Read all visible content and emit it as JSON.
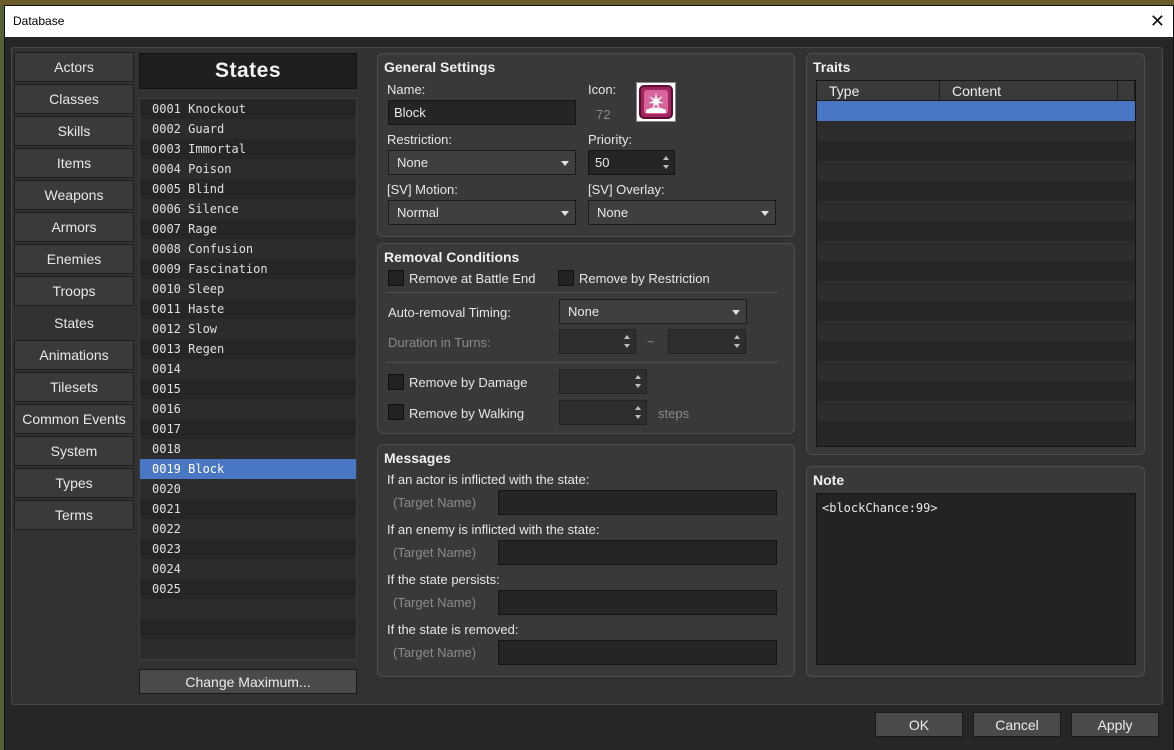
{
  "window": {
    "title": "Database",
    "close_glyph": "✕"
  },
  "categories": [
    {
      "label": "Actors"
    },
    {
      "label": "Classes"
    },
    {
      "label": "Skills"
    },
    {
      "label": "Items"
    },
    {
      "label": "Weapons"
    },
    {
      "label": "Armors"
    },
    {
      "label": "Enemies"
    },
    {
      "label": "Troops"
    },
    {
      "label": "States",
      "active": true
    },
    {
      "label": "Animations"
    },
    {
      "label": "Tilesets"
    },
    {
      "label": "Common Events"
    },
    {
      "label": "System"
    },
    {
      "label": "Types"
    },
    {
      "label": "Terms"
    }
  ],
  "states_list": {
    "title": "States",
    "selected_index": 18,
    "items": [
      "0001 Knockout",
      "0002 Guard",
      "0003 Immortal",
      "0004 Poison",
      "0005 Blind",
      "0006 Silence",
      "0007 Rage",
      "0008 Confusion",
      "0009 Fascination",
      "0010 Sleep",
      "0011 Haste",
      "0012 Slow",
      "0013 Regen",
      "0014",
      "0015",
      "0016",
      "0017",
      "0018",
      "0019 Block",
      "0020",
      "0021",
      "0022",
      "0023",
      "0024",
      "0025"
    ],
    "change_max_label": "Change Maximum..."
  },
  "general": {
    "title": "General Settings",
    "name_label": "Name:",
    "name_value": "Block",
    "icon_label": "Icon:",
    "icon_index": "72",
    "icon_name": "block-state-icon",
    "restriction_label": "Restriction:",
    "restriction_value": "None",
    "priority_label": "Priority:",
    "priority_value": "50",
    "motion_label": "[SV] Motion:",
    "motion_value": "Normal",
    "overlay_label": "[SV] Overlay:",
    "overlay_value": "None"
  },
  "removal": {
    "title": "Removal Conditions",
    "battle_end_label": "Remove at Battle End",
    "restriction_label": "Remove by Restriction",
    "auto_timing_label": "Auto-removal Timing:",
    "auto_timing_value": "None",
    "duration_label": "Duration in Turns:",
    "tilde": "~",
    "damage_label": "Remove by Damage",
    "walking_label": "Remove by Walking",
    "steps_label": "steps"
  },
  "messages": {
    "title": "Messages",
    "target_placeholder": "(Target Name)",
    "rows": [
      {
        "label": "If an actor is inflicted with the state:"
      },
      {
        "label": "If an enemy is inflicted with the state:"
      },
      {
        "label": "If the state persists:"
      },
      {
        "label": "If the state is removed:"
      }
    ]
  },
  "traits": {
    "title": "Traits",
    "columns": [
      "Type",
      "Content"
    ]
  },
  "note": {
    "title": "Note",
    "text": "<blockChance:99>"
  },
  "footer": {
    "ok": "OK",
    "cancel": "Cancel",
    "apply": "Apply"
  },
  "colors": {
    "selection": "#4a77c4",
    "icon_accent": "#a3235e"
  }
}
